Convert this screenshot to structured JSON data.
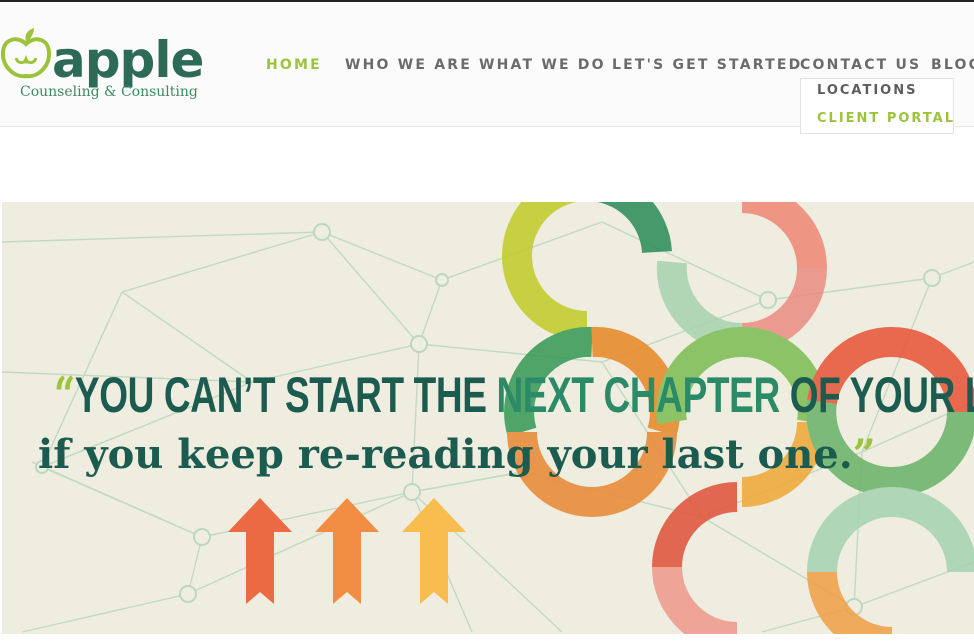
{
  "brand": {
    "name": "apple",
    "tagline": "Counseling & Consulting",
    "colors": {
      "primary": "#2e6a58",
      "accent": "#9cc33b",
      "tagline": "#3d8a62"
    }
  },
  "nav": {
    "items": [
      {
        "label": "HOME",
        "active": true
      },
      {
        "label": "WHO WE ARE",
        "active": false
      },
      {
        "label": "WHAT WE DO",
        "active": false
      },
      {
        "label": "LET'S GET STARTED",
        "active": false
      },
      {
        "label": "CONTACT US",
        "active": false
      },
      {
        "label": "BLOG",
        "active": false
      }
    ],
    "dropdown": [
      {
        "label": "LOCATIONS"
      },
      {
        "label": "CLIENT PORTAL"
      }
    ]
  },
  "hero": {
    "open_quote": "“",
    "close_quote": "”",
    "line1_a": "YOU CAN’T START THE ",
    "line1_b": "NEXT CHAPTER",
    "line1_c": " OF YOUR LIFE",
    "line2": "if you keep re-reading your last one.",
    "colors": {
      "text": "#1c5c50",
      "highlight": "#2b8a68",
      "background": "#efeddf"
    }
  }
}
